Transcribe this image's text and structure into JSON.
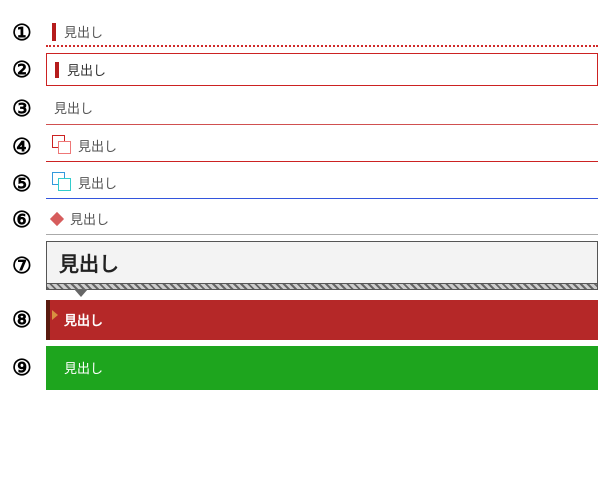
{
  "numbers": [
    "①",
    "②",
    "③",
    "④",
    "⑤",
    "⑥",
    "⑦",
    "⑧",
    "⑨"
  ],
  "heading_text": "見出し",
  "colors": {
    "accent_red": "#b51c1c",
    "underline_red": "#c22",
    "underline_blue": "#3355dd",
    "underline_grey": "#aaa",
    "bar_red": "#b52828",
    "bar_red_edge": "#5a1a10",
    "bar_green": "#1ea51e",
    "box_grey_bg": "#f3f3f3",
    "box_grey_border": "#555"
  },
  "styles": [
    {
      "id": 1,
      "description": "left-tick-with-dotted-red-underline"
    },
    {
      "id": 2,
      "description": "red-outline-box-with-left-tick"
    },
    {
      "id": 3,
      "description": "plain-text-thin-red-underline"
    },
    {
      "id": 4,
      "description": "red-squares-icon-red-underline"
    },
    {
      "id": 5,
      "description": "blue-squares-icon-blue-underline"
    },
    {
      "id": 6,
      "description": "diamond-icon-grey-underline"
    },
    {
      "id": 7,
      "description": "bold-boxed-grey-heading-with-hatched-tab"
    },
    {
      "id": 8,
      "description": "solid-red-bar-white-text"
    },
    {
      "id": 9,
      "description": "solid-green-bar-white-text"
    }
  ]
}
